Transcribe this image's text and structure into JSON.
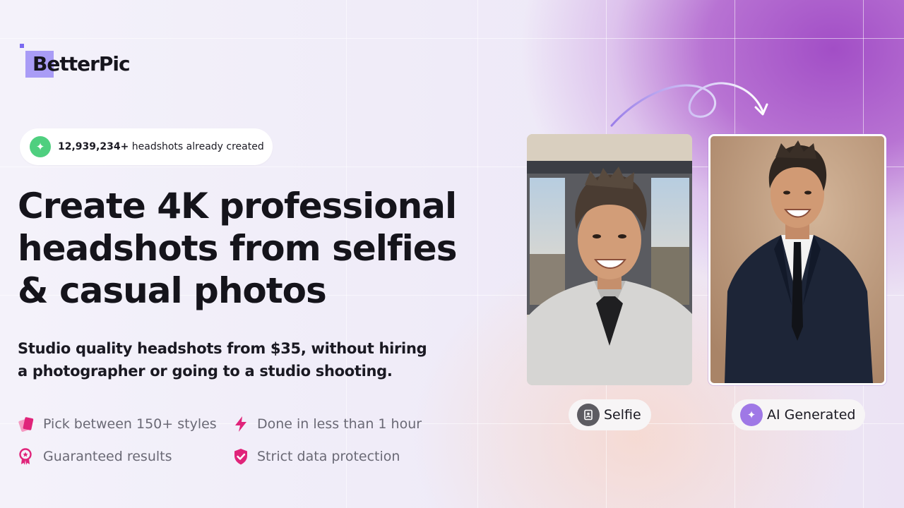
{
  "brand": {
    "name": "BetterPic",
    "accent": "#a99cf6",
    "accent_dark": "#7b6af0"
  },
  "counter": {
    "count": "12,939,234+",
    "label": "headshots already created",
    "icon": "sparkle-icon",
    "icon_color": "#4fcf7f"
  },
  "hero": {
    "line1": "Create 4K professional",
    "line2": "headshots from selfies",
    "line3": "& casual photos",
    "sub1": "Studio quality headshots from $35, without hiring",
    "sub2": "a photographer or going to a studio shooting."
  },
  "features": [
    {
      "label": "Pick between 150+ styles",
      "icon": "cards-icon"
    },
    {
      "label": "Done in less than 1 hour",
      "icon": "lightning-icon"
    },
    {
      "label": "Guaranteed results",
      "icon": "award-ribbon-icon"
    },
    {
      "label": "Strict data protection",
      "icon": "shield-check-icon"
    }
  ],
  "feature_color": "#e0247a",
  "comparison": {
    "before_label": "Selfie",
    "before_icon": "portrait-icon",
    "after_label": "AI Generated",
    "after_icon": "sparkle-icon",
    "after_icon_color": "#9f78e6"
  }
}
